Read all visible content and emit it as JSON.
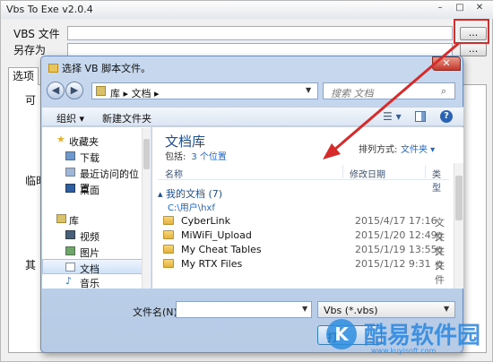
{
  "app": {
    "title": "Vbs To Exe v2.0.4",
    "controls": {
      "minimize": "–",
      "maximize": "□",
      "close": "✕"
    },
    "vbs_file_label": "VBS 文件",
    "save_as_label": "另存为",
    "browse_label": "...",
    "tab_options": "选项",
    "panel_fragments": [
      "可",
      "临时",
      "其"
    ]
  },
  "dialog": {
    "title": "选择 VB 脚本文件。",
    "close": "✕",
    "nav": {
      "back": "◀",
      "forward": "▶"
    },
    "address": {
      "segments": "库 ▸ 文档 ▸",
      "dropdown": "▼"
    },
    "refresh": "⟳",
    "search": {
      "placeholder": "搜索 文档",
      "icon": "search-icon"
    },
    "toolbar": {
      "organize": "组织 ▾",
      "new_folder": "新建文件夹",
      "view": "☰ ▾",
      "help": "?"
    },
    "nav_pane": [
      {
        "label": "收藏夹",
        "icon": "star-icon"
      },
      {
        "label": "下载",
        "icon": "download-icon"
      },
      {
        "label": "最近访问的位置",
        "icon": "recent-icon"
      },
      {
        "label": "桌面",
        "icon": "desktop-icon"
      },
      {
        "label": "库",
        "icon": "library-icon"
      },
      {
        "label": "视频",
        "icon": "video-icon"
      },
      {
        "label": "图片",
        "icon": "picture-icon"
      },
      {
        "label": "文档",
        "icon": "document-icon"
      },
      {
        "label": "音乐",
        "icon": "music-icon"
      }
    ],
    "library": {
      "title": "文档库",
      "includes": "包括:",
      "locations": "3 个位置",
      "arrange_label": "排列方式:",
      "arrange_value": "文件夹 ▾"
    },
    "columns": [
      "名称",
      "修改日期",
      "类型"
    ],
    "group": {
      "header": "▴ 我的文档 (7)",
      "path": "C:\\用户\\hxf"
    },
    "files": [
      {
        "name": "CyberLink",
        "date": "2015/4/17 17:16",
        "type": "文件"
      },
      {
        "name": "MiWiFi_Upload",
        "date": "2015/1/20 12:49",
        "type": "文件"
      },
      {
        "name": "My Cheat Tables",
        "date": "2015/1/19 13:55",
        "type": "文件"
      },
      {
        "name": "My RTX Files",
        "date": "2015/1/12 9:31",
        "type": "文件"
      }
    ],
    "filename_label": "文件名(N):",
    "filename_value": "",
    "filename_dropdown": "▼",
    "filter_value": "Vbs (*.vbs)",
    "filter_dropdown": "▼",
    "open_label": "打"
  },
  "watermark": {
    "logo": "K",
    "text": "酷易软件园",
    "url": "www.kuyisoft.com"
  },
  "colors": {
    "accent_red": "#d62b2b",
    "link_blue": "#1f66c9",
    "title_blue": "#1f4f8f"
  }
}
